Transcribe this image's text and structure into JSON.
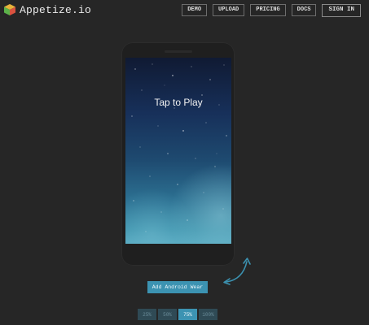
{
  "brand": {
    "name": "Appetize.io",
    "icon": "cube-logo-icon"
  },
  "nav": [
    {
      "id": "demo",
      "label": "DEMO"
    },
    {
      "id": "upload",
      "label": "UPLOAD"
    },
    {
      "id": "pricing",
      "label": "PRICING"
    },
    {
      "id": "docs",
      "label": "DOCS"
    },
    {
      "id": "signin",
      "label": "SIGN IN"
    }
  ],
  "device": {
    "screen_text": "Tap to Play",
    "rotate_icon": "rotate-arrow-icon"
  },
  "actions": {
    "add_wear_label": "Add Android Wear"
  },
  "zoom": {
    "options": [
      "25%",
      "50%",
      "75%",
      "100%"
    ],
    "selected": "75%"
  },
  "colors": {
    "accent": "#3c93b2",
    "background": "#262626"
  }
}
